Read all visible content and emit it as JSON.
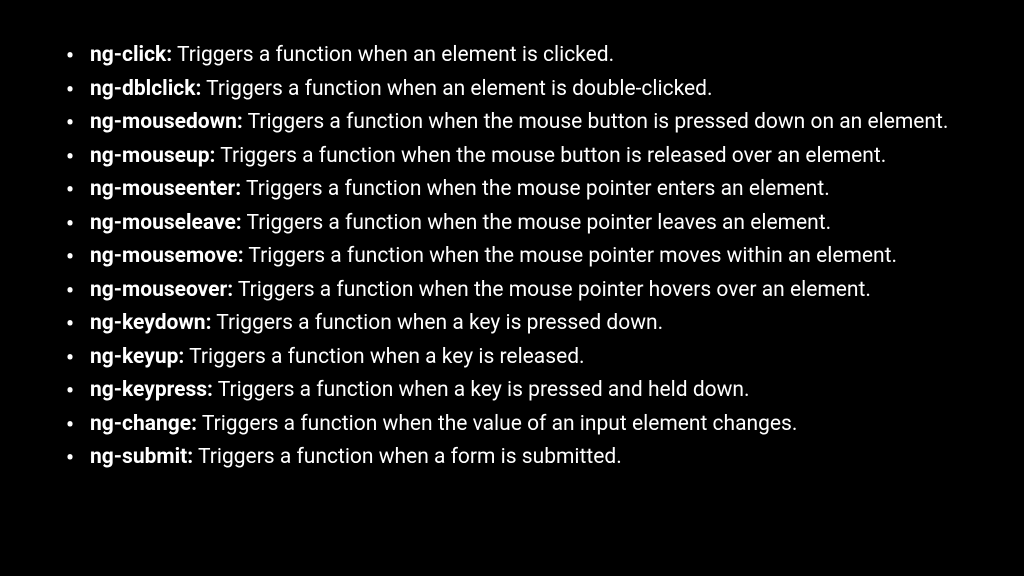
{
  "directives": [
    {
      "term": "ng-click:",
      "desc": " Triggers a function when an element is clicked."
    },
    {
      "term": "ng-dblclick:",
      "desc": " Triggers a function when an element is double-clicked."
    },
    {
      "term": "ng-mousedown:",
      "desc": " Triggers a function when the mouse button is pressed down on an element."
    },
    {
      "term": "ng-mouseup:",
      "desc": " Triggers a function when the mouse button is released over an element."
    },
    {
      "term": "ng-mouseenter:",
      "desc": " Triggers a function when the mouse pointer enters an element."
    },
    {
      "term": "ng-mouseleave:",
      "desc": " Triggers a function when the mouse pointer leaves an element."
    },
    {
      "term": "ng-mousemove:",
      "desc": " Triggers a function when the mouse pointer moves within an element."
    },
    {
      "term": "ng-mouseover:",
      "desc": " Triggers a function when the mouse pointer hovers over an element."
    },
    {
      "term": "ng-keydown:",
      "desc": " Triggers a function when a key is pressed down."
    },
    {
      "term": "ng-keyup:",
      "desc": " Triggers a function when a key is released."
    },
    {
      "term": "ng-keypress:",
      "desc": " Triggers a function when a key is pressed and held down."
    },
    {
      "term": "ng-change:",
      "desc": " Triggers a function when the value of an input element changes."
    },
    {
      "term": "ng-submit:",
      "desc": " Triggers a function when a form is submitted."
    }
  ]
}
